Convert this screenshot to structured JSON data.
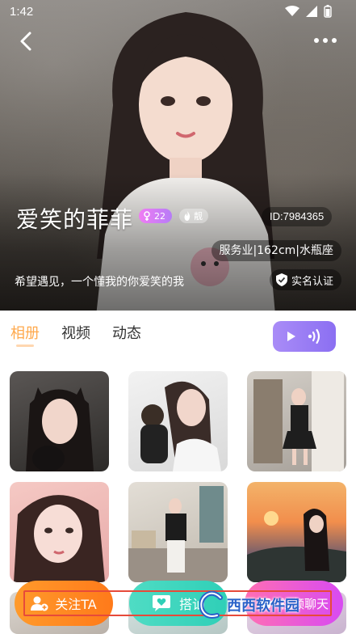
{
  "status_bar": {
    "time": "1:42"
  },
  "profile": {
    "nickname": "爱笑的菲菲",
    "age": "22",
    "tag": "靓",
    "user_id": "ID:7984365",
    "info": "服务业|162cm|水瓶座",
    "bio": "希望遇见，一个懂我的你爱笑的我",
    "verified_label": "实名认证"
  },
  "tabs": [
    {
      "label": "相册",
      "active": true
    },
    {
      "label": "视频",
      "active": false
    },
    {
      "label": "动态",
      "active": false
    }
  ],
  "album": {
    "photo_count": 9
  },
  "actions": {
    "follow_label": "关注TA",
    "chat_label": "搭讪",
    "video_label": "视频聊天"
  },
  "watermark": {
    "text": "西西软件园"
  },
  "colors": {
    "accent_orange": "#ff8a24",
    "accent_teal": "#2fcfb7",
    "accent_pink": "#e24ee8",
    "voice_purple": "#9b7df5",
    "tab_active": "#ffa94d"
  }
}
